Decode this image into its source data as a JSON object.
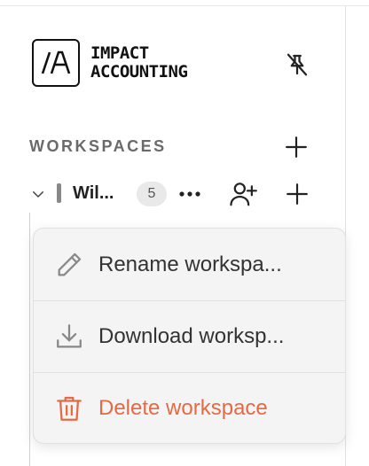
{
  "brand": {
    "logo_mark_text": "/A",
    "name_line1": "IMPACT",
    "name_line2": "ACCOUNTING"
  },
  "sidebar": {
    "workspaces_header": "WORKSPACES",
    "workspace": {
      "name": "Wil...",
      "count": "5",
      "color": "#888888"
    }
  },
  "context_menu": {
    "items": [
      {
        "label": "Rename workspa...",
        "icon": "pencil-icon"
      },
      {
        "label": "Download worksp...",
        "icon": "download-icon"
      },
      {
        "label": "Delete workspace",
        "icon": "trash-icon",
        "color": "#e56a44"
      }
    ]
  },
  "colors": {
    "danger": "#e56a44",
    "text": "#333333",
    "muted": "#6a6a6a",
    "menu_bg": "#f4f4f4"
  }
}
